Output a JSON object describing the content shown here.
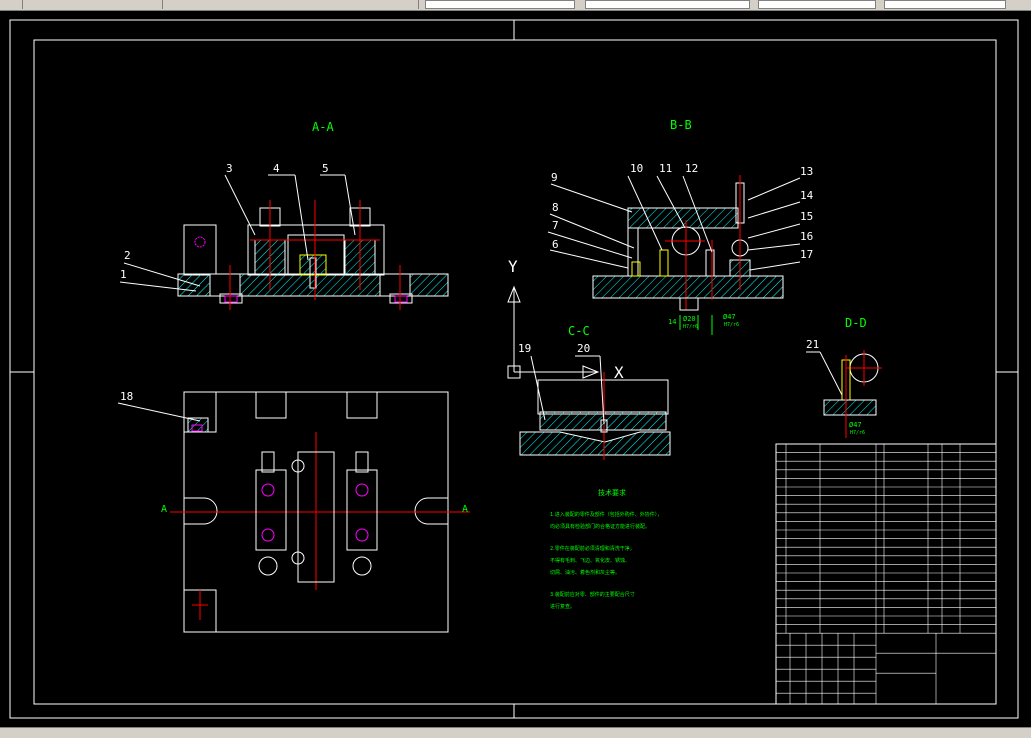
{
  "app": {
    "toolbar": {
      "layer_fields": [
        "",
        "",
        "",
        ""
      ]
    },
    "status": ""
  },
  "colors": {
    "background": "#000000",
    "outline": "#ffffff",
    "title": "#00ff00",
    "centerline": "#ff0000",
    "hatch": "#00ffff",
    "highlight": "#ff00ff",
    "part": "#ffff00"
  },
  "drawing": {
    "views": {
      "aa": "A-A",
      "bb": "B-B",
      "cc": "C-C",
      "dd": "D-D"
    },
    "ucs": {
      "y": "Y",
      "x": "X"
    },
    "section_marks": {
      "a_left": "A",
      "a_right": "A"
    },
    "balloons": [
      "1",
      "2",
      "3",
      "4",
      "5",
      "6",
      "7",
      "8",
      "9",
      "10",
      "11",
      "12",
      "13",
      "14",
      "15",
      "16",
      "17",
      "18",
      "19",
      "20",
      "21"
    ],
    "dims": {
      "bb_fit1": "Ø20",
      "bb_fit1_tol": "H7/r6",
      "bb_fit2": "14",
      "bb_fit3": "Ø47",
      "bb_fit3_tol": "H7/r6",
      "dd_fit": "Ø47",
      "dd_fit_tol": "H7/r6"
    },
    "tech_notes": {
      "title": "技术要求",
      "lines": [
        "1.进入装配的零件及部件（包括外购件、外协件），",
        "均必须具有检验部门的合格证方能进行装配。",
        "2.零件在装配前必须清理和清洗干净，",
        "不得有毛刺、飞边、氧化皮、锈蚀、",
        "切屑、油污、着色剂和灰尘等。",
        "3.装配前应对零、部件的主要配合尺寸",
        "进行复查。"
      ]
    }
  }
}
